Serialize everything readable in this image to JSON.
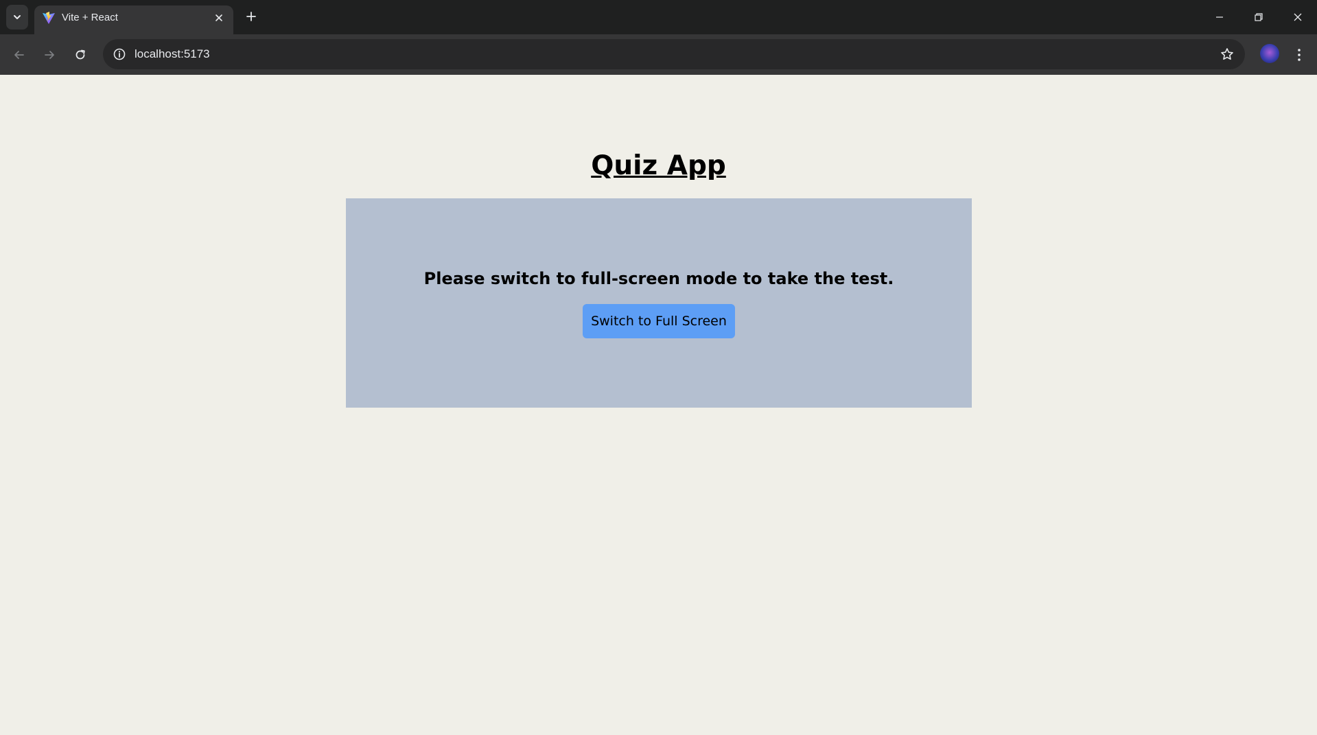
{
  "browser": {
    "tab": {
      "title": "Vite + React",
      "favicon": "vite-logo-icon"
    },
    "address_bar": {
      "url": "localhost:5173"
    }
  },
  "page": {
    "title": "Quiz App",
    "panel": {
      "message": "Please switch to full-screen mode to take the test.",
      "button_label": "Switch to Full Screen"
    }
  },
  "colors": {
    "page_background": "#f0efe8",
    "panel_background": "#b4bfd0",
    "button_background": "#5d9ef5",
    "chrome_dark": "#1f2020",
    "chrome_toolbar": "#363637"
  }
}
